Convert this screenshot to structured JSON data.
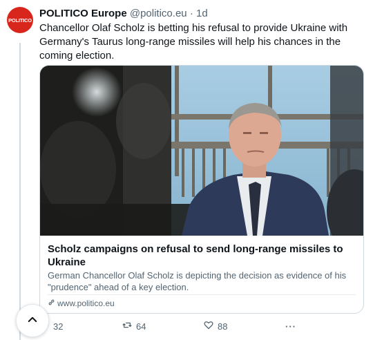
{
  "tweet": {
    "avatar_text": "POLITICO",
    "author_name": "POLITICO Europe",
    "handle": "@politico.eu",
    "separator": "·",
    "timestamp": "1d",
    "text": "Chancellor Olaf Scholz is betting his refusal to provide Ukraine with Germany's Taurus long-range missiles will help his chances in the coming election."
  },
  "card": {
    "title": "Scholz campaigns on refusal to send long-range missiles to Ukraine",
    "description": "German Chancellor Olaf Scholz is depicting the decision as evidence of his \"prudence\" ahead of a key election.",
    "domain": "www.politico.eu"
  },
  "actions": {
    "replies": "32",
    "reposts": "64",
    "likes": "88",
    "more": "···"
  },
  "icons": [
    "avatar-logo",
    "link-icon",
    "reply-icon",
    "repost-icon",
    "like-icon",
    "more-icon",
    "chevron-up-icon"
  ]
}
